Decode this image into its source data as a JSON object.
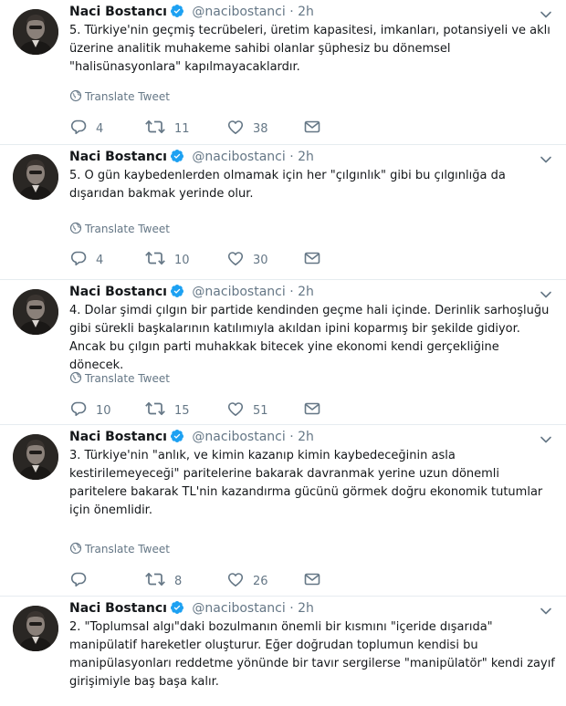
{
  "tweets": [
    {
      "name": "Naci Bostancı",
      "handle": "@nacibostanci",
      "dot": "·",
      "time": "2h",
      "text": "5. Türkiye'nin geçmiş tecrübeleri, üretim kapasitesi, imkanları, potansiyeli ve aklı üzerine analitik muhakeme sahibi olanlar şüphesiz bu dönemsel \"halisünasyonlara\" kapılmayacaklardır.",
      "translate": "Translate Tweet",
      "replies": "4",
      "retweets": "11",
      "likes": "38"
    },
    {
      "name": "Naci Bostancı",
      "handle": "@nacibostanci",
      "dot": "·",
      "time": "2h",
      "text": "5. O gün kaybedenlerden olmamak için her \"çılgınlık\" gibi bu çılgınlığa da dışarıdan bakmak yerinde olur.",
      "translate": "Translate Tweet",
      "replies": "4",
      "retweets": "10",
      "likes": "30"
    },
    {
      "name": "Naci Bostancı",
      "handle": "@nacibostanci",
      "dot": "·",
      "time": "2h",
      "text": "4. Dolar şimdi çılgın bir partide kendinden geçme hali içinde. Derinlik sarhoşluğu gibi sürekli başkalarının katılımıyla akıldan ipini koparmış bir şekilde gidiyor. Ancak bu çılgın parti muhakkak bitecek yine ekonomi kendi gerçekliğine dönecek.",
      "translate": "Translate Tweet",
      "replies": "10",
      "retweets": "15",
      "likes": "51"
    },
    {
      "name": "Naci Bostancı",
      "handle": "@nacibostanci",
      "dot": "·",
      "time": "2h",
      "text": "3. Türkiye'nin \"anlık, ve kimin kazanıp kimin kaybedeceğinin asla kestirilemeyeceği\" paritelerine bakarak davranmak yerine uzun dönemli paritelere bakarak TL'nin kazandırma gücünü görmek doğru ekonomik tutumlar için önemlidir.",
      "translate": "Translate Tweet",
      "replies": "",
      "retweets": "8",
      "likes": "26"
    },
    {
      "name": "Naci Bostancı",
      "handle": "@nacibostanci",
      "dot": "·",
      "time": "2h",
      "text": "2. \"Toplumsal algı\"daki bozulmanın önemli bir kısmını \"içeride dışarıda\" manipülatif hareketler oluşturur. Eğer doğrudan toplumun kendisi bu manipülasyonları reddetme yönünde bir tavır sergilerse \"manipülatör\" kendi zayıf girişimiyle baş başa kalır."
    }
  ],
  "colors": {
    "verified": "#1da1f2",
    "muted": "#657786",
    "text": "#14171a"
  },
  "icons": [
    "verified-badge-icon",
    "chevron-down-icon",
    "globe-icon",
    "reply-icon",
    "retweet-icon",
    "like-icon",
    "message-icon"
  ]
}
